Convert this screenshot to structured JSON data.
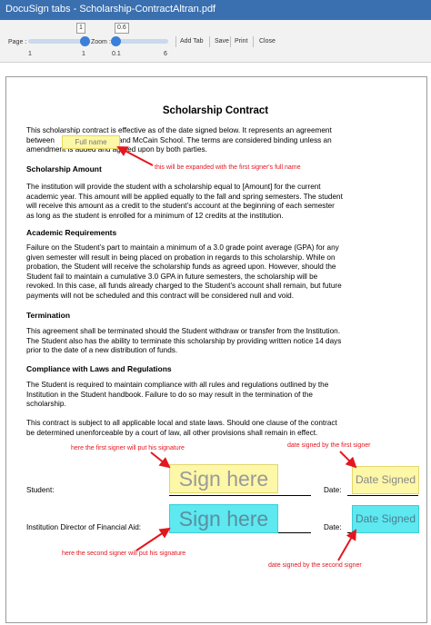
{
  "window": {
    "title": "DocuSign tabs - Scholarship-ContractAltran.pdf"
  },
  "toolbar": {
    "page_label": "Page :",
    "page_value": "1",
    "page_min": "1",
    "page_max": "1",
    "page_level": 1.0,
    "zoom_label": "Zoom :",
    "zoom_value": "0.6",
    "zoom_min": "0.1",
    "zoom_max": "6",
    "zoom_level": 0.08,
    "add_tab": "Add Tab",
    "save": "Save",
    "print": "Print",
    "close": "Close"
  },
  "document": {
    "title": "Scholarship Contract",
    "intro_1": "This scholarship contract is effective as of the date signed below. It represents an agreement",
    "intro_2a": "between",
    "intro_2b": "and McCain School. The terms are considered binding unless an",
    "intro_3": "amendment is added and agreed upon by both parties.",
    "section_amount": "Scholarship Amount",
    "amount_text": [
      "The institution will provide the student with a scholarship equal to [Amount] for the current",
      "academic year. This amount will be applied equally to the fall and spring semesters. The student",
      "will receive this amount as a credit to the student’s account at the beginning of each semester",
      "as long as the student is enrolled for a minimum of 12 credits at the institution."
    ],
    "section_requirements": "Academic Requirements",
    "requirements_text": [
      "Failure on the Student’s part to maintain a minimum of a 3.0 grade point average (GPA) for any",
      "given semester will result in being placed on probation in regards to this scholarship. While on",
      "probation, the Student will receive the scholarship funds as agreed upon. However, should the",
      "Student fail to maintain a cumulative 3.0 GPA in future semesters, the scholarship will be",
      "revoked. In this case, all funds already charged to the Student’s account shall remain, but future",
      "payments will not be scheduled and this contract will be considered null and void."
    ],
    "section_termination": "Termination",
    "termination_text": [
      "This agreement shall be terminated should the Student withdraw or transfer from the Institution.",
      "The Student also has the ability to terminate this scholarship by providing written notice 14 days",
      "prior to the date of a new distribution of funds."
    ],
    "section_compliance": "Compliance with Laws and Regulations",
    "compliance_text": [
      "The Student is required to maintain compliance with all rules and regulations outlined by the",
      "Institution in the Student handbook. Failure to do so may result in the termination of the",
      "scholarship."
    ],
    "law_text": [
      "This contract is subject to all applicable local and state laws.  Should one clause of the contract",
      "be determined unenforceable by a court of law, all other provisions shall remain in effect."
    ],
    "student_label": "Student:",
    "director_label": "Institution Director of Financial Aid:",
    "date_label": "Date:"
  },
  "tabs": {
    "full_name": "Full name",
    "sign_here_1": "Sign here",
    "sign_here_2": "Sign here",
    "date_signed_1": "Date Signed",
    "date_signed_2": "Date Signed"
  },
  "annotations": {
    "full_name_note": "this will be expanded with the first signer's full name",
    "signer1_note": "here the first signer will put his signature",
    "date1_note": "date signed by the first signer",
    "signer2_note": "here the second signer will put his signature",
    "date2_note": "date signed by the second signer"
  },
  "colors": {
    "titlebar": "#3a6fb0",
    "signer1_tab": "#fdf7a8",
    "signer2_tab": "#5ee8f0",
    "annotation": "#e3161f"
  }
}
